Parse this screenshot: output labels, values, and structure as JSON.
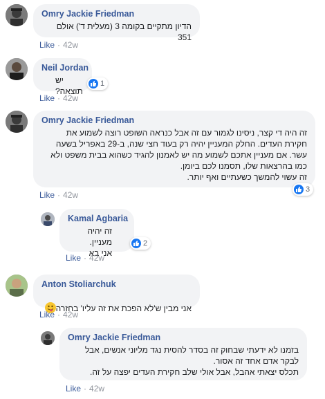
{
  "like_label": "Like",
  "separator": "·",
  "comments": [
    {
      "author": "Omry Jackie Friedman",
      "text": "הדיון מתקיים בקומה 3 (מעלית ד') אולם 351",
      "time": "42w"
    },
    {
      "author": "Neil Jordan",
      "text": "יש תוצאה?",
      "time": "42w",
      "reactions": "1"
    },
    {
      "author": "Omry Jackie Friedman",
      "text": "זה היה די קצר, ניסינו לגמור עם זה אבל כנראה השופט רוצה לשמוע את\nחקירת העדים. החלק המעניין יהיה רק בעוד חצי שנה, ב-29 באפריל בשעה\nעשר. אם מעניין אתכם לשמוע מה יש לאמנון להגיד כשהוא בבית משפט ולא\nכמו בהרצאות שלו, תסמנו לכם ביומן.\nזה עשוי להמשך כשעתיים ואף יותר.",
      "time": "42w",
      "reactions": "3"
    },
    {
      "author": "Kamal Agbaria",
      "text": "זה יהיה מעניין.\nאני בא",
      "time": "42w",
      "reactions": "2"
    },
    {
      "author": "Anton Stoliarchuk",
      "text": "אני מבין ש'לא הפכת את זה עליו' בחזרה",
      "time": "42w"
    },
    {
      "author": "Omry Jackie Friedman",
      "text": "בזמנו לא ידעתי שבחוק זה בסדר להסית נגד מליוני אנשים, אבל\nלבקר אדם אחד זה אסור.\nתכלס יצאתי אהבל, אבל אולי שלב חקירת העדים יפצה על זה.",
      "time": "42w"
    }
  ]
}
